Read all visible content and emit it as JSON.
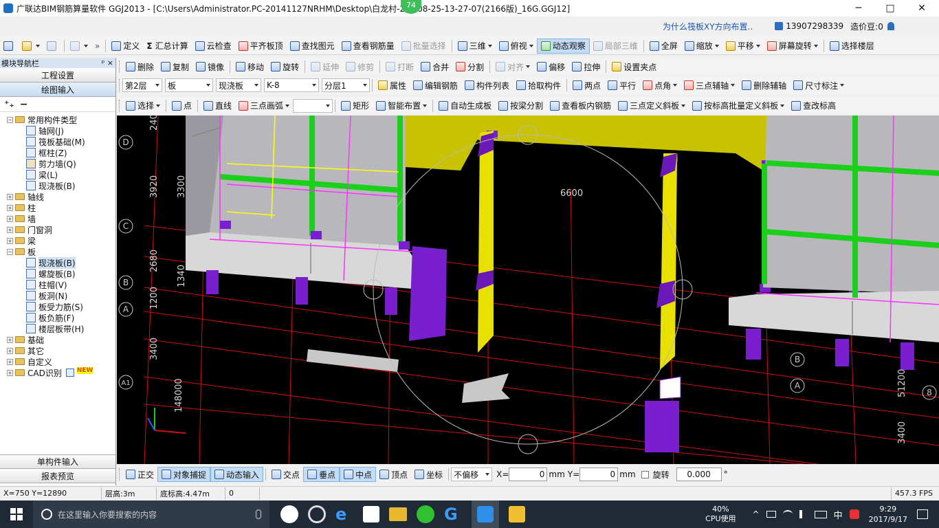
{
  "window": {
    "title": "广联达BIM钢筋算量软件 GGJ2013 - [C:\\Users\\Administrator.PC-20141127NRHM\\Desktop\\白龙村-2",
    "title_tail": "08-25-13-27-07(2166版)_16G.GGJ12]",
    "badge": "74",
    "minimize": "─",
    "maximize": "□",
    "close": "✕"
  },
  "menu_right": {
    "question": "为什么筏板XY方向布置..",
    "phone": "13907298339",
    "bean": "造价豆:0"
  },
  "toolbar1": {
    "items": [
      "定义",
      "汇总计算",
      "云检查",
      "平齐板顶",
      "查找图元",
      "查看钢筋量",
      "批量选择",
      "三维",
      "俯视",
      "动态观察",
      "局部三维",
      "全屏",
      "缩放",
      "平移",
      "屏幕旋转",
      "选择楼层"
    ]
  },
  "toolbar2": {
    "items": [
      "删除",
      "复制",
      "镜像",
      "移动",
      "旋转",
      "延伸",
      "修剪",
      "打断",
      "合并",
      "分割",
      "对齐",
      "偏移",
      "拉伸",
      "设置夹点"
    ]
  },
  "toolbar3": {
    "floor": "第2层",
    "type": "板",
    "subtype": "现浇板",
    "name": "K-8",
    "layer": "分层1",
    "items": [
      "属性",
      "编辑钢筋",
      "构件列表",
      "拾取构件",
      "两点",
      "平行",
      "点角",
      "三点辅轴",
      "删除辅轴",
      "尺寸标注"
    ]
  },
  "toolbar4": {
    "items": [
      "选择",
      "点",
      "直线",
      "三点画弧",
      "矩形",
      "智能布置",
      "自动生成板",
      "按梁分割",
      "查看板内钢筋",
      "三点定义斜板",
      "按标高批量定义斜板",
      "查改标高"
    ]
  },
  "nav": {
    "title": "模块导航栏",
    "pin": "ᵖ",
    "close": "×",
    "btn_settings": "工程设置",
    "btn_drawing": "绘图输入",
    "common_group": "常用构件类型",
    "common_items": [
      "轴网(J)",
      "筏板基础(M)",
      "框柱(Z)",
      "剪力墙(Q)",
      "梁(L)",
      "现浇板(B)"
    ],
    "groups": [
      "轴线",
      "柱",
      "墙",
      "门窗洞",
      "梁"
    ],
    "slab_group": "板",
    "slab_items": [
      "现浇板(B)",
      "螺旋板(B)",
      "柱帽(V)",
      "板洞(N)",
      "板受力筋(S)",
      "板负筋(F)",
      "楼层板带(H)"
    ],
    "groups2": [
      "基础",
      "其它",
      "自定义",
      "CAD识别"
    ],
    "new_badge": "NEW",
    "btn_single": "单构件输入",
    "btn_report": "报表预览"
  },
  "viewport": {
    "dim_labels": [
      "240",
      "3920",
      "3300",
      "2680",
      "1340",
      "1200",
      "3400",
      "148000",
      "6600",
      "3400",
      "51200"
    ],
    "axis_labels": [
      "D",
      "C",
      "B",
      "A",
      "A1",
      "B",
      "A",
      "8"
    ]
  },
  "snapbar": {
    "items": [
      "正交",
      "对象捕捉",
      "动态输入",
      "交点",
      "垂点",
      "中点",
      "顶点",
      "坐标"
    ],
    "offset": "不偏移",
    "x_label": "X=",
    "x_val": "0",
    "y_label": "Y=",
    "y_val": "0",
    "unit": "mm",
    "rotate": "旋转",
    "rot_val": "0.000",
    "deg": "°"
  },
  "status": {
    "coords": "X=750 Y=12890",
    "floor_h": "层高:3m",
    "bottom_h": "底标高:4.47m",
    "zero": "0",
    "fps": "457.3 FPS"
  },
  "taskbar": {
    "search": "在这里输入你要搜索的内容",
    "cpu_pct": "40%",
    "cpu_label": "CPU使用",
    "ime": "中",
    "time": "9:29",
    "date": "2017/9/17"
  }
}
